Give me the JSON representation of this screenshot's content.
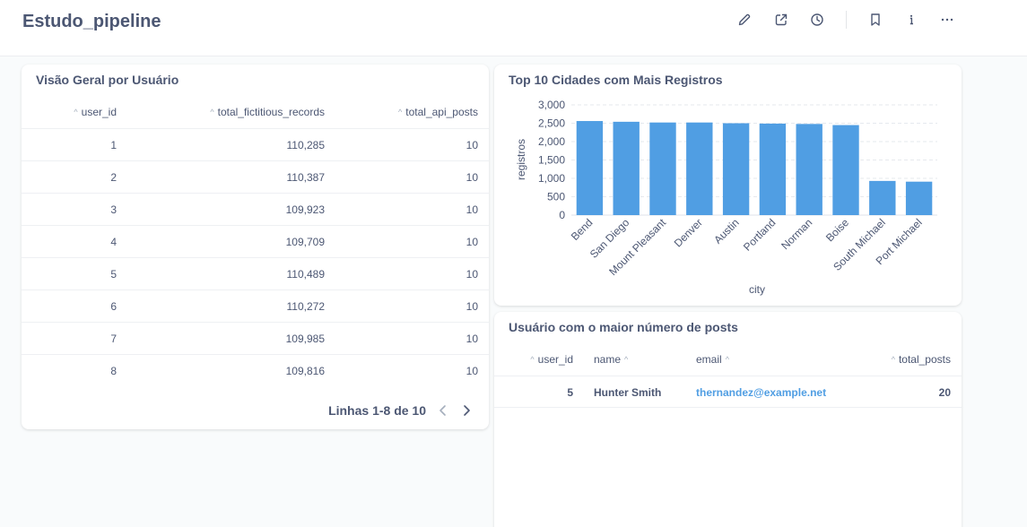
{
  "dashboard": {
    "title": "Estudo_pipeline"
  },
  "header_icons": [
    "pencil-icon",
    "share-icon",
    "history-icon",
    "bookmark-icon",
    "info-icon",
    "more-icon"
  ],
  "overview": {
    "title": "Visão Geral por Usuário",
    "columns": [
      "user_id",
      "total_fictitious_records",
      "total_api_posts"
    ],
    "rows": [
      [
        "1",
        "110,285",
        "10"
      ],
      [
        "2",
        "110,387",
        "10"
      ],
      [
        "3",
        "109,923",
        "10"
      ],
      [
        "4",
        "109,709",
        "10"
      ],
      [
        "5",
        "110,489",
        "10"
      ],
      [
        "6",
        "110,272",
        "10"
      ],
      [
        "7",
        "109,985",
        "10"
      ],
      [
        "8",
        "109,816",
        "10"
      ]
    ],
    "pager_label": "Linhas 1-8 de 10"
  },
  "top_cities": {
    "title": "Top 10 Cidades com Mais Registros",
    "chart_data": {
      "type": "bar",
      "title": "Top 10 Cidades com Mais Registros",
      "xlabel": "city",
      "ylabel": "registros",
      "categories": [
        "Bend",
        "San Diego",
        "Mount Pleasant",
        "Denver",
        "Austin",
        "Portland",
        "Norman",
        "Boise",
        "South Michael",
        "Port Michael"
      ],
      "values": [
        2560,
        2540,
        2520,
        2520,
        2500,
        2490,
        2480,
        2450,
        930,
        910
      ],
      "ylim": [
        0,
        3000
      ],
      "yticks": [
        "0",
        "500",
        "1,000",
        "1,500",
        "2,000",
        "2,500",
        "3,000"
      ],
      "grid": true,
      "bar_color": "#509ee3"
    }
  },
  "top_user": {
    "title": "Usuário com o maior número de posts",
    "columns": [
      "user_id",
      "name",
      "email",
      "total_posts"
    ],
    "rows": [
      [
        "5",
        "Hunter Smith",
        "thernandez@example.net",
        "20"
      ]
    ]
  },
  "colors": {
    "accent": "#509ee3",
    "text": "#4c5773"
  }
}
